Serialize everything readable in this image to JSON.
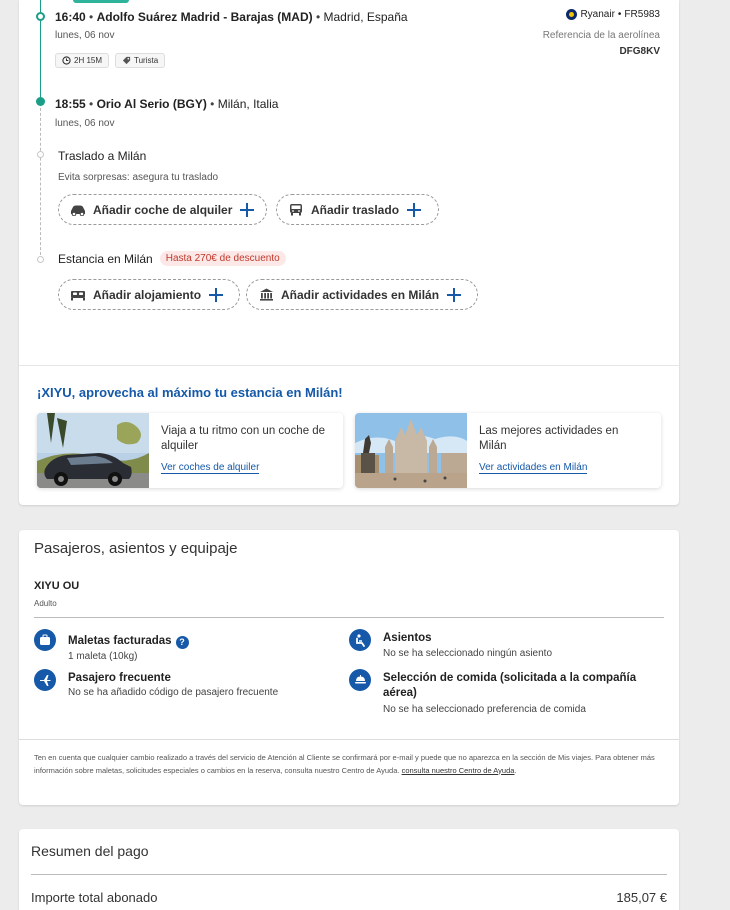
{
  "flight": {
    "departure": {
      "time": "16:40",
      "airport": "Adolfo Suárez Madrid - Barajas (MAD)",
      "city": "Madrid, España",
      "date": "lunes, 06 nov"
    },
    "duration": "2H 15M",
    "cabin": "Turista",
    "arrival": {
      "time": "18:55",
      "airport": "Orio Al Serio (BGY)",
      "city": "Milán, Italia",
      "date": "lunes, 06 nov"
    },
    "airline": "Ryanair",
    "flight_number": "FR5983",
    "ref_label": "Referencia de la aerolínea",
    "ref_code": "DFG8KV"
  },
  "transfer": {
    "title": "Traslado a Milán",
    "subtitle": "Evita sorpresas: asegura tu traslado",
    "car_label": "Añadir coche de alquiler",
    "transfer_label": "Añadir traslado"
  },
  "stay": {
    "title": "Estancia en Milán",
    "badge": "Hasta 270€ de descuento",
    "hotel_label": "Añadir alojamiento",
    "activities_label": "Añadir actividades en Milán"
  },
  "promo": {
    "title": "¡XIYU, aprovecha al máximo tu estancia en Milán!",
    "cards": [
      {
        "text": "Viaja a tu ritmo con un coche de alquiler",
        "link": "Ver coches de alquiler"
      },
      {
        "text": "Las mejores actividades en Milán",
        "link": "Ver actividades en Milán"
      }
    ]
  },
  "passengers": {
    "title": "Pasajeros, asientos y equipaje",
    "name": "XIYU OU",
    "type": "Adulto",
    "services": {
      "bags": {
        "title": "Maletas facturadas",
        "value": "1 maleta (10kg)"
      },
      "seats": {
        "title": "Asientos",
        "value": "No se ha seleccionado ningún asiento"
      },
      "frequent": {
        "title": "Pasajero frecuente",
        "value": "No se ha añadido código de pasajero frecuente"
      },
      "meal": {
        "title": "Selección de comida (solicitada a la compañía aérea)",
        "value": "No se ha seleccionado preferencia de comida"
      }
    },
    "note": "Ten en cuenta que cualquier cambio realizado a través del servicio de Atención al Cliente se confirmará por e-mail y puede que no aparezca en la sección de Mis viajes. Para obtener más información sobre maletas, solicitudes especiales o cambios en la reserva, consulta nuestro Centro de Ayuda.",
    "note_link": "consulta nuestro Centro de Ayuda",
    "note_end": "."
  },
  "payment": {
    "title": "Resumen del pago",
    "total_label": "Importe total abonado",
    "total_amount": "185,07 €"
  },
  "colors": {
    "accent": "#1559a8",
    "timeline": "#1a9e87",
    "badge_text": "#c0392b",
    "badge_bg": "#fde8e8"
  }
}
